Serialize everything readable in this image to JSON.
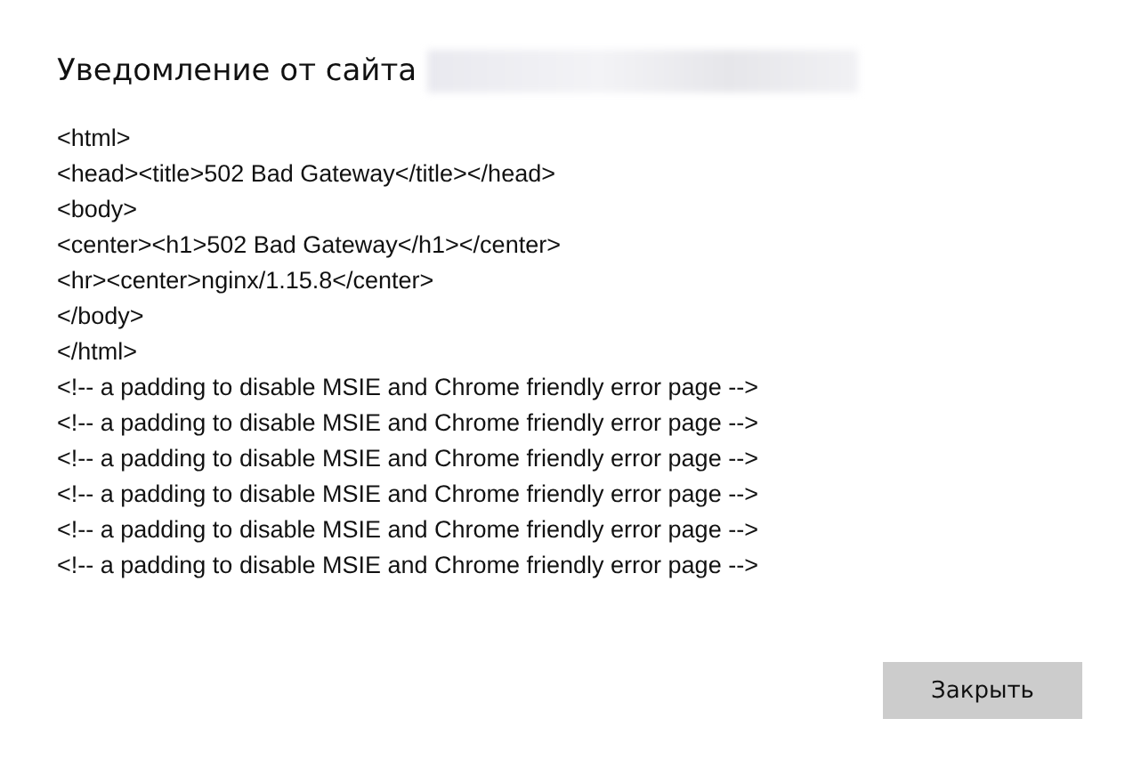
{
  "dialog": {
    "title": "Уведомление от сайта",
    "lines": [
      "<html>",
      "<head><title>502 Bad Gateway</title></head>",
      "<body>",
      "<center><h1>502 Bad Gateway</h1></center>",
      "<hr><center>nginx/1.15.8</center>",
      "</body>",
      "</html>",
      "<!-- a padding to disable MSIE and Chrome friendly error page -->",
      "<!-- a padding to disable MSIE and Chrome friendly error page -->",
      "<!-- a padding to disable MSIE and Chrome friendly error page -->",
      "<!-- a padding to disable MSIE and Chrome friendly error page -->",
      "<!-- a padding to disable MSIE and Chrome friendly error page -->",
      "<!-- a padding to disable MSIE and Chrome friendly error page -->"
    ],
    "buttons": [
      "Закрыть"
    ]
  }
}
